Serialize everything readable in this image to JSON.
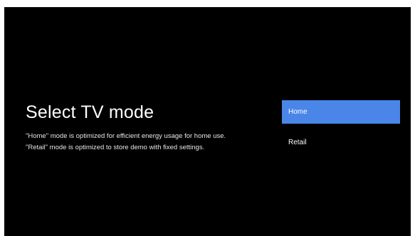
{
  "page": {
    "title": "Select TV mode",
    "description": [
      "\"Home\" mode is optimized for efficient energy usage for home use.",
      "\"Retail\" mode is optimized to store demo with fixed settings."
    ]
  },
  "options": [
    {
      "label": "Home",
      "selected": true
    },
    {
      "label": "Retail",
      "selected": false
    }
  ],
  "colors": {
    "background": "#000000",
    "selected_highlight": "#4a86e8",
    "text": "#ffffff"
  }
}
